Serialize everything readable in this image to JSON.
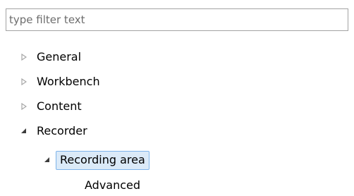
{
  "filter": {
    "placeholder": "type filter text",
    "value": ""
  },
  "tree": {
    "items": [
      {
        "label": "General",
        "state": "collapsed"
      },
      {
        "label": "Workbench",
        "state": "collapsed"
      },
      {
        "label": "Content",
        "state": "collapsed"
      },
      {
        "label": "Recorder",
        "state": "expanded"
      },
      {
        "label": "Recording area",
        "state": "expanded",
        "selected": true
      },
      {
        "label": "Advanced",
        "state": "leaf"
      }
    ]
  },
  "colors": {
    "selection_background": "#dbeaf8",
    "selection_border": "#7eb4ea",
    "input_border": "#a3a3a3",
    "placeholder_text": "#6d6d6d",
    "collapsed_arrow": "#a6a6a6",
    "expanded_arrow": "#3c3c3c"
  }
}
